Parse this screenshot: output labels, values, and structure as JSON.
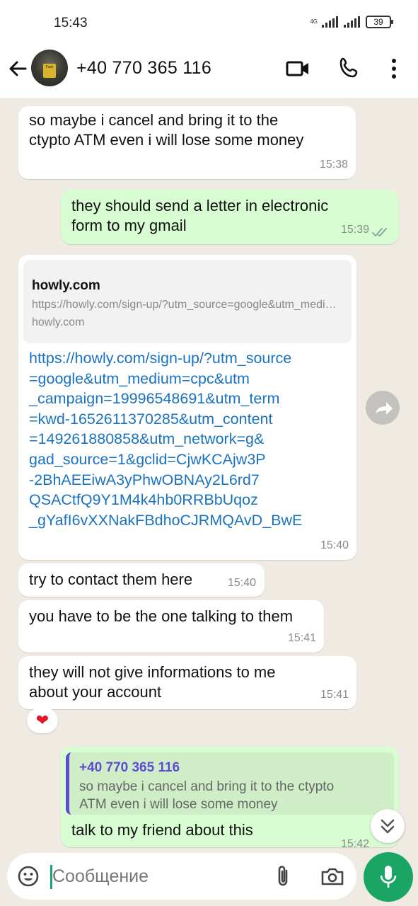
{
  "status_bar": {
    "time": "15:43",
    "network_label": "4G",
    "battery": "39"
  },
  "header": {
    "contact_name": "+40 770 365 116",
    "avatar_sign": "Fast"
  },
  "messages": [
    {
      "text": "so maybe i cancel and bring it to the\nctypto ATM even i will lose some money",
      "time": "15:38"
    },
    {
      "text": "they should send a letter in electronic\nform to my gmail",
      "time": "15:39"
    },
    {
      "preview_title": "howly.com",
      "preview_url": "https://howly.com/sign-up/?utm_source=google&utm_medium=cpc",
      "preview_domain": "howly.com",
      "text": "https://howly.com/sign-up/?utm_source\n=google&utm_medium=cpc&utm\n_campaign=19996548691&utm_term\n=kwd-1652611370285&utm_content\n=149261880858&utm_network=g&\ngad_source=1&gclid=CjwKCAjw3P\n-2BhAEEiwA3yPhwOBNAy2L6rd7\nQSACtfQ9Y1M4k4hb0RRBbUqoz\n_gYafI6vXXNakFBdhoCJRMQAvD_BwE",
      "time": "15:40"
    },
    {
      "text": "try to contact them here",
      "time": "15:40"
    },
    {
      "text": "you have to be the one talking to them",
      "time": "15:41"
    },
    {
      "text": "they will not give informations to me\nabout your account",
      "time": "15:41",
      "reaction": "❤"
    },
    {
      "quote_author": "+40 770 365 116",
      "quote_text": "so maybe i cancel and bring it to the ctypto\nATM even i will lose some money",
      "text": "talk to my friend about this",
      "time": "15:42"
    }
  ],
  "composer": {
    "placeholder": "Сообщение"
  },
  "colors": {
    "outgoing_bubble": "#d9fdd3",
    "incoming_bubble": "#ffffff",
    "chat_background": "#efeae2",
    "link": "#1a73c2",
    "accent_green": "#1aa564",
    "quote_accent": "#5e4bd6"
  },
  "icons": [
    "back-arrow-icon",
    "video-call-icon",
    "phone-icon",
    "more-vert-icon",
    "forward-icon",
    "double-check-icon",
    "chevron-double-down-icon",
    "emoji-icon",
    "attach-icon",
    "camera-icon",
    "mic-icon"
  ]
}
